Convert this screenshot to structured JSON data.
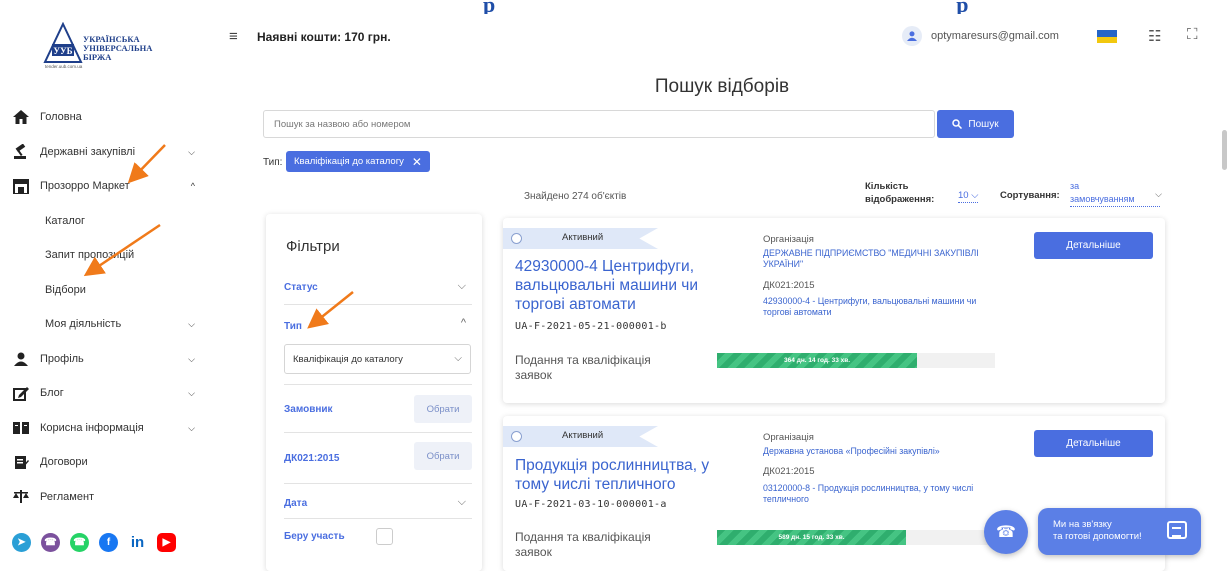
{
  "header_fragment": "           p                    p                  y",
  "logo": {
    "line1": "УКРАЇНСЬКА",
    "line2": "УНІВЕРСАЛЬНА",
    "line3": "БІРЖА",
    "url": "tender.uub.com.ua"
  },
  "topbar": {
    "balance": "Наявні кошти: 170 грн.",
    "email": "optymaresurs@gmail.com"
  },
  "sidebar": {
    "items": [
      {
        "label": "Головна",
        "icon": "home-icon"
      },
      {
        "label": "Державні закупівлі",
        "icon": "auction-icon"
      },
      {
        "label": "Прозорро Маркет",
        "icon": "store-icon"
      },
      {
        "label": "Каталог"
      },
      {
        "label": "Запит пропозицій"
      },
      {
        "label": "Відбори"
      },
      {
        "label": "Моя діяльність"
      },
      {
        "label": "Профіль",
        "icon": "user-icon"
      },
      {
        "label": "Блог",
        "icon": "edit-icon"
      },
      {
        "label": "Корисна інформація",
        "icon": "book-icon"
      },
      {
        "label": "Договори",
        "icon": "contract-icon"
      },
      {
        "label": "Регламент",
        "icon": "scales-icon"
      }
    ]
  },
  "page": {
    "title": "Пошук відборів",
    "search_placeholder": "Пошук за назвою або номером",
    "search_button": "Пошук",
    "type_label": "Тип:",
    "type_chip": "Кваліфікація до каталогу",
    "found": "Знайдено 274 об'єктів",
    "count_label_1": "Кількість",
    "count_label_2": "відображення:",
    "count_value": "10",
    "sort_label": "Сортування:",
    "sort_value_1": "за",
    "sort_value_2": "замовчуванням"
  },
  "filters": {
    "title": "Фільтри",
    "status": "Статус",
    "type": "Тип",
    "type_value": "Кваліфікація до каталогу",
    "customer": "Замовник",
    "dk": "ДК021:2015",
    "pick": "Обрати",
    "date": "Дата",
    "participate": "Беру участь"
  },
  "cards": [
    {
      "status": "Активний",
      "title": "42930000-4 Центрифуги, вальцювальні машини чи торгові автомати",
      "code": "UA-F-2021-05-21-000001-b",
      "stage": "Подання та кваліфікація заявок",
      "progress_text": "364 дн. 14 год. 33 хв.",
      "progress_fraction": 0.72,
      "org_label": "Організація",
      "org": "ДЕРЖАВНЕ ПІДПРИЄМСТВО \"МЕДИЧНІ ЗАКУПІВЛІ УКРАЇНИ\"",
      "dk_label": "ДК021:2015",
      "dk": "42930000-4 - Центрифуги, вальцювальні машини чи торгові автомати",
      "button": "Детальніше"
    },
    {
      "status": "Активний",
      "title": "Продукція рослинництва, у тому числі тепличного",
      "code": "UA-F-2021-03-10-000001-a",
      "stage": "Подання та кваліфікація заявок",
      "progress_text": "589 дн. 15 год. 33 хв.",
      "progress_fraction": 0.68,
      "org_label": "Організація",
      "org": "Державна установа «Професійні закупівлі»",
      "dk_label": "ДК021:2015",
      "dk": "03120000-8 - Продукція рослинництва, у тому числі тепличного",
      "button": "Детальніше"
    }
  ],
  "help": {
    "line1": "Ми на зв'язку",
    "line2": "та готові допомогти!"
  },
  "colors": {
    "accent": "#4a6ee0",
    "link": "#3a64cf",
    "progress": "#2fae6e",
    "annotation_arrow": "#f07a1a"
  }
}
